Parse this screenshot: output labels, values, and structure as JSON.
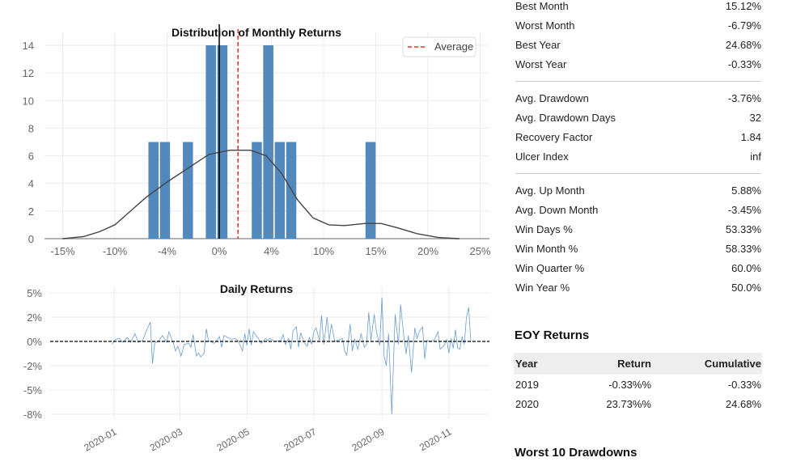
{
  "chart_data": [
    {
      "type": "histogram",
      "title": "Distribution of Monthly Returns",
      "x_ticks": [
        {
          "value": -15,
          "label": "-15%"
        },
        {
          "value": -10,
          "label": "-10%"
        },
        {
          "value": -5,
          "label": "-4%"
        },
        {
          "value": 0,
          "label": "0%"
        },
        {
          "value": 5,
          "label": "4%"
        },
        {
          "value": 10,
          "label": "10%"
        },
        {
          "value": 15,
          "label": "15%"
        },
        {
          "value": 20,
          "label": "20%"
        },
        {
          "value": 25,
          "label": "25%"
        }
      ],
      "y_ticks": [
        0,
        2,
        4,
        6,
        8,
        10,
        12,
        14
      ],
      "xlim": [
        -16,
        26
      ],
      "ylim": [
        0,
        14.6
      ],
      "bin_width": 1.05,
      "bins": [
        {
          "center": -6.3,
          "count": 7
        },
        {
          "center": -5.2,
          "count": 7
        },
        {
          "center": -3.0,
          "count": 7
        },
        {
          "center": -0.8,
          "count": 14
        },
        {
          "center": 0.3,
          "count": 14
        },
        {
          "center": 3.6,
          "count": 7
        },
        {
          "center": 4.7,
          "count": 14
        },
        {
          "center": 5.8,
          "count": 7
        },
        {
          "center": 6.9,
          "count": 7
        },
        {
          "center": 14.5,
          "count": 7
        }
      ],
      "kde": [
        [
          -15,
          0
        ],
        [
          -13,
          0.15
        ],
        [
          -11.5,
          0.5
        ],
        [
          -10,
          1.0
        ],
        [
          -8.5,
          2.0
        ],
        [
          -7,
          3.0
        ],
        [
          -5,
          4.1
        ],
        [
          -3,
          5.1
        ],
        [
          -1,
          6.1
        ],
        [
          1,
          6.4
        ],
        [
          3,
          6.4
        ],
        [
          4.5,
          6.0
        ],
        [
          6,
          4.7
        ],
        [
          7.5,
          2.8
        ],
        [
          9,
          1.5
        ],
        [
          10.5,
          1.0
        ],
        [
          12,
          0.95
        ],
        [
          14,
          1.1
        ],
        [
          15.5,
          1.1
        ],
        [
          17,
          0.8
        ],
        [
          19,
          0.35
        ],
        [
          21,
          0.08
        ],
        [
          23,
          0
        ]
      ],
      "zero_line": 0,
      "average": 1.8,
      "legend": {
        "label": "Average",
        "position": "top-right"
      },
      "bar_color": "#5189bd",
      "average_color": "#e8302a",
      "grid": true
    },
    {
      "type": "line",
      "title": "Daily Returns",
      "y_ticks": [
        {
          "value": 5,
          "label": "5%"
        },
        {
          "value": 2.5,
          "label": "2%"
        },
        {
          "value": 0,
          "label": "0%"
        },
        {
          "value": -2.5,
          "label": "-2%"
        },
        {
          "value": -5,
          "label": "-5%"
        },
        {
          "value": -7.5,
          "label": "-8%"
        }
      ],
      "x_ticks": [
        "2020-01",
        "2020-03",
        "2020-05",
        "2020-07",
        "2020-09",
        "2020-11"
      ],
      "ylim": [
        -8.3,
        5.6
      ],
      "xlim": [
        "2019-09-10",
        "2020-12-15"
      ],
      "line_color": "#4f8cc4",
      "grid": true,
      "series": [
        [
          "2019-12-30",
          -0.3
        ],
        [
          "2020-01-02",
          0.2
        ],
        [
          "2020-01-06",
          0.3
        ],
        [
          "2020-01-09",
          -0.1
        ],
        [
          "2020-01-13",
          0.4
        ],
        [
          "2020-01-16",
          -0.1
        ],
        [
          "2020-01-20",
          0.8
        ],
        [
          "2020-01-23",
          -0.1
        ],
        [
          "2020-01-27",
          0.1
        ],
        [
          "2020-01-30",
          1.0
        ],
        [
          "2020-02-03",
          2.0
        ],
        [
          "2020-02-05",
          -2.3
        ],
        [
          "2020-02-07",
          -0.2
        ],
        [
          "2020-02-11",
          0.1
        ],
        [
          "2020-02-14",
          0.6
        ],
        [
          "2020-02-18",
          -0.1
        ],
        [
          "2020-02-20",
          1.0
        ],
        [
          "2020-02-24",
          -0.2
        ],
        [
          "2020-02-26",
          -1.0
        ],
        [
          "2020-02-28",
          -0.5
        ],
        [
          "2020-03-02",
          -1.5
        ],
        [
          "2020-03-05",
          -0.3
        ],
        [
          "2020-03-09",
          -0.2
        ],
        [
          "2020-03-11",
          -0.6
        ],
        [
          "2020-03-13",
          0.7
        ],
        [
          "2020-03-16",
          -1.5
        ],
        [
          "2020-03-18",
          -1.2
        ],
        [
          "2020-03-20",
          -1.6
        ],
        [
          "2020-03-23",
          -1.2
        ],
        [
          "2020-03-25",
          1.3
        ],
        [
          "2020-03-27",
          0.1
        ],
        [
          "2020-04-01",
          -0.2
        ],
        [
          "2020-04-03",
          0.0
        ],
        [
          "2020-04-06",
          0.5
        ],
        [
          "2020-04-08",
          -0.6
        ],
        [
          "2020-04-10",
          0.6
        ],
        [
          "2020-04-14",
          0.4
        ],
        [
          "2020-04-17",
          0.2
        ],
        [
          "2020-04-20",
          0.3
        ],
        [
          "2020-04-23",
          0.1
        ],
        [
          "2020-04-27",
          -1.0
        ],
        [
          "2020-04-29",
          0.8
        ],
        [
          "2020-05-01",
          -0.4
        ],
        [
          "2020-05-03",
          1.3
        ],
        [
          "2020-05-05",
          -0.4
        ],
        [
          "2020-05-07",
          1.0
        ],
        [
          "2020-05-12",
          0.2
        ],
        [
          "2020-05-14",
          -0.2
        ],
        [
          "2020-05-18",
          0.3
        ],
        [
          "2020-05-20",
          0.1
        ],
        [
          "2020-05-22",
          0.3
        ],
        [
          "2020-05-26",
          0.0
        ],
        [
          "2020-06-01",
          0.1
        ],
        [
          "2020-06-03",
          0.7
        ],
        [
          "2020-06-05",
          -0.3
        ],
        [
          "2020-06-08",
          0.3
        ],
        [
          "2020-06-10",
          -0.8
        ],
        [
          "2020-06-12",
          1.1
        ],
        [
          "2020-06-15",
          1.5
        ],
        [
          "2020-06-17",
          -0.6
        ],
        [
          "2020-06-19",
          0.9
        ],
        [
          "2020-06-22",
          -0.1
        ],
        [
          "2020-06-25",
          -0.5
        ],
        [
          "2020-06-27",
          0.4
        ],
        [
          "2020-06-29",
          -0.3
        ],
        [
          "2020-07-01",
          1.0
        ],
        [
          "2020-07-03",
          1.4
        ],
        [
          "2020-07-06",
          0.1
        ],
        [
          "2020-07-08",
          2.7
        ],
        [
          "2020-07-10",
          -0.3
        ],
        [
          "2020-07-13",
          2.5
        ],
        [
          "2020-07-15",
          0.1
        ],
        [
          "2020-07-17",
          1.8
        ],
        [
          "2020-07-20",
          0.0
        ],
        [
          "2020-07-27",
          0.3
        ],
        [
          "2020-07-29",
          -1.0
        ],
        [
          "2020-07-31",
          -1.4
        ],
        [
          "2020-08-03",
          1.8
        ],
        [
          "2020-08-05",
          -1.0
        ],
        [
          "2020-08-07",
          0.3
        ],
        [
          "2020-08-10",
          -0.8
        ],
        [
          "2020-08-13",
          0.8
        ],
        [
          "2020-08-16",
          -0.6
        ],
        [
          "2020-08-18",
          -0.3
        ],
        [
          "2020-08-20",
          3.0
        ],
        [
          "2020-08-22",
          0.1
        ],
        [
          "2020-08-25",
          2.8
        ],
        [
          "2020-08-27",
          1.0
        ],
        [
          "2020-08-30",
          -0.4
        ],
        [
          "2020-09-01",
          4.5
        ],
        [
          "2020-09-03",
          -1.5
        ],
        [
          "2020-09-05",
          -2.5
        ],
        [
          "2020-09-07",
          0.8
        ],
        [
          "2020-09-10",
          -7.5
        ],
        [
          "2020-09-13",
          2.8
        ],
        [
          "2020-09-16",
          -0.3
        ],
        [
          "2020-09-18",
          3.8
        ],
        [
          "2020-09-21",
          0.5
        ],
        [
          "2020-09-23",
          -1.3
        ],
        [
          "2020-09-25",
          0.6
        ],
        [
          "2020-09-28",
          -3.2
        ],
        [
          "2020-10-01",
          1.4
        ],
        [
          "2020-10-03",
          0.3
        ],
        [
          "2020-10-05",
          1.0
        ],
        [
          "2020-10-08",
          1.5
        ],
        [
          "2020-10-10",
          -1.8
        ],
        [
          "2020-10-12",
          0.1
        ],
        [
          "2020-10-16",
          0.0
        ],
        [
          "2020-10-19",
          0.2
        ],
        [
          "2020-10-22",
          1.0
        ],
        [
          "2020-10-24",
          -0.8
        ],
        [
          "2020-10-27",
          -0.5
        ],
        [
          "2020-10-30",
          0.2
        ],
        [
          "2020-11-01",
          -1.2
        ],
        [
          "2020-11-03",
          0.3
        ],
        [
          "2020-11-05",
          -0.7
        ],
        [
          "2020-11-07",
          1.2
        ],
        [
          "2020-11-09",
          -0.7
        ],
        [
          "2020-11-11",
          -0.8
        ],
        [
          "2020-11-13",
          0.5
        ],
        [
          "2020-11-15",
          -0.3
        ],
        [
          "2020-11-17",
          2.5
        ],
        [
          "2020-11-19",
          3.5
        ],
        [
          "2020-11-21",
          0.0
        ]
      ]
    }
  ],
  "metrics": {
    "group1": [
      {
        "label": "Best Month",
        "value": "15.12%"
      },
      {
        "label": "Worst Month",
        "value": "-6.79%"
      },
      {
        "label": "Best Year",
        "value": "24.68%"
      },
      {
        "label": "Worst Year",
        "value": "-0.33%"
      }
    ],
    "group2": [
      {
        "label": "Avg. Drawdown",
        "value": "-3.76%"
      },
      {
        "label": "Avg. Drawdown Days",
        "value": "32"
      },
      {
        "label": "Recovery Factor",
        "value": "1.84"
      },
      {
        "label": "Ulcer Index",
        "value": "inf"
      }
    ],
    "group3": [
      {
        "label": "Avg. Up Month",
        "value": "5.88%"
      },
      {
        "label": "Avg. Down Month",
        "value": "-3.45%"
      },
      {
        "label": "Win Days %",
        "value": "53.33%"
      },
      {
        "label": "Win Month %",
        "value": "58.33%"
      },
      {
        "label": "Win Quarter %",
        "value": "60.0%"
      },
      {
        "label": "Win Year %",
        "value": "50.0%"
      }
    ]
  },
  "eoy": {
    "title": "EOY Returns",
    "headers": [
      "Year",
      "Return",
      "Cumulative"
    ],
    "rows": [
      [
        "2019",
        "-0.33%%",
        "-0.33%"
      ],
      [
        "2020",
        "23.73%%",
        "24.68%"
      ]
    ]
  },
  "drawdowns": {
    "title": "Worst 10 Drawdowns"
  }
}
